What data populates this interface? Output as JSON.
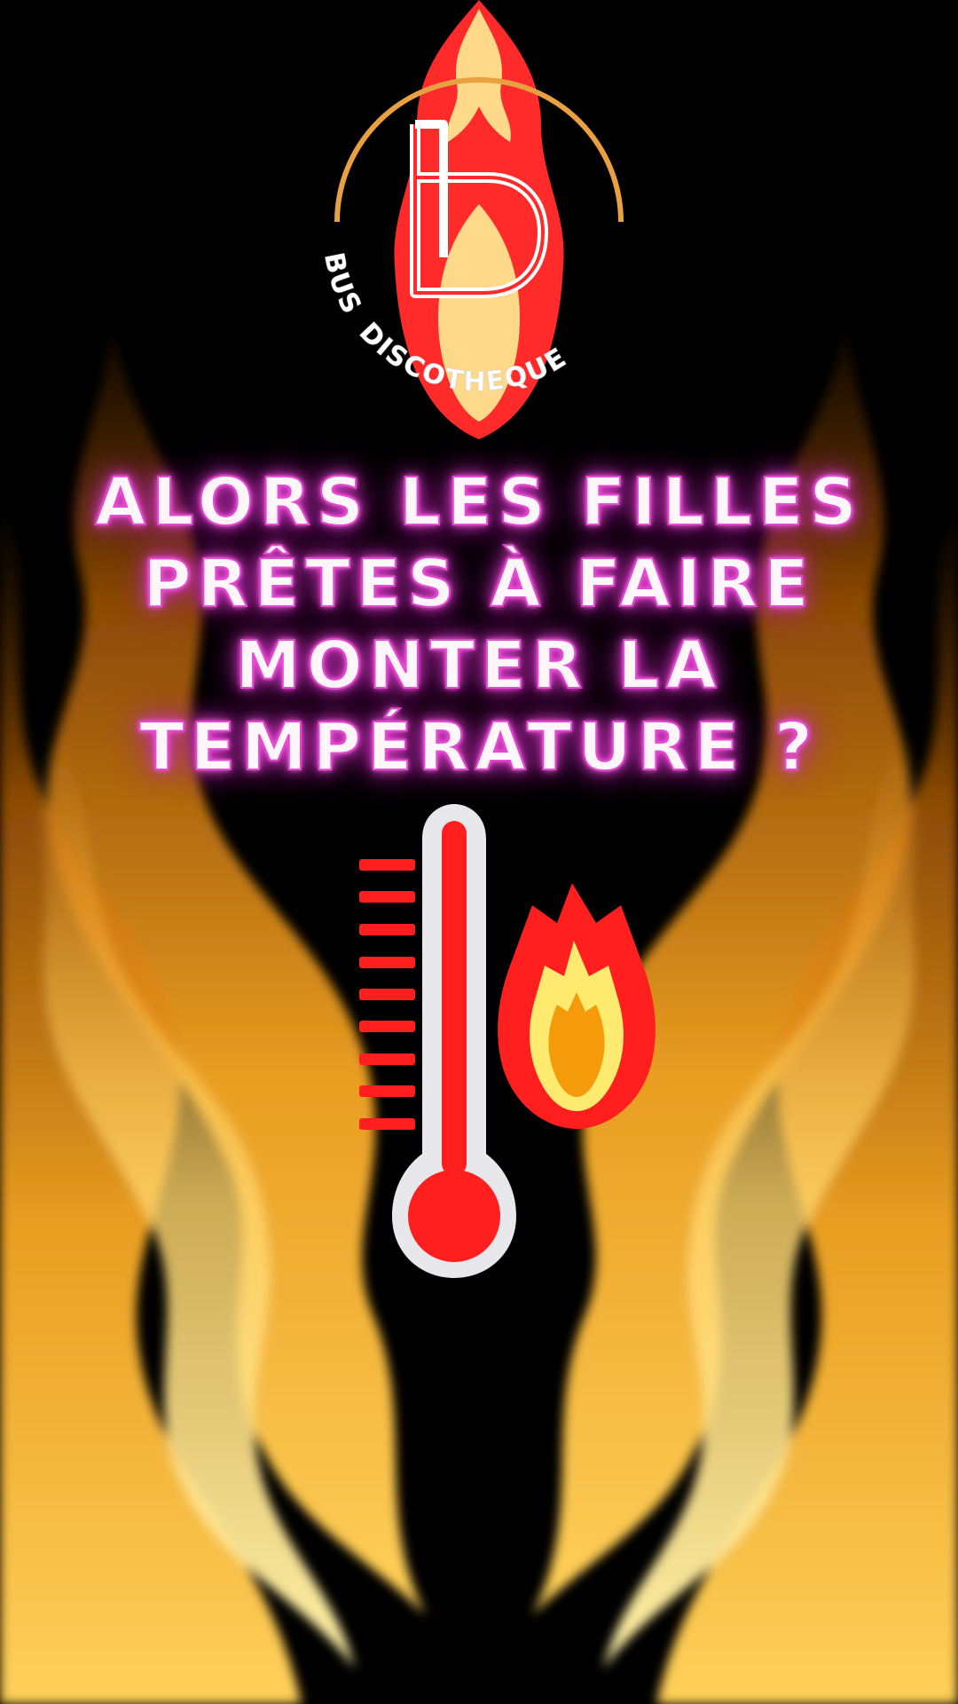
{
  "logo": {
    "letter": "B",
    "brand_word_1": "BUS",
    "brand_word_2": "DISCOTHEQUE"
  },
  "headline": {
    "lines": [
      "ALORS LES FILLES",
      "PRÊTES À FAIRE",
      "MONTER LA",
      "TEMPÉRATURE ?"
    ]
  },
  "icons": {
    "flames_background": "flames-icon",
    "logo_flame": "flame-icon",
    "thermometer": "thermometer-icon",
    "fire": "fire-icon"
  },
  "colors": {
    "background": "#000000",
    "neon_pink": "#e44ad0",
    "flame_orange": "#f5a623",
    "thermo_red": "#ff1f1f",
    "fire_yellow": "#ffea70",
    "fire_orange": "#f59a0a",
    "logo_ring": "#e9a040"
  }
}
